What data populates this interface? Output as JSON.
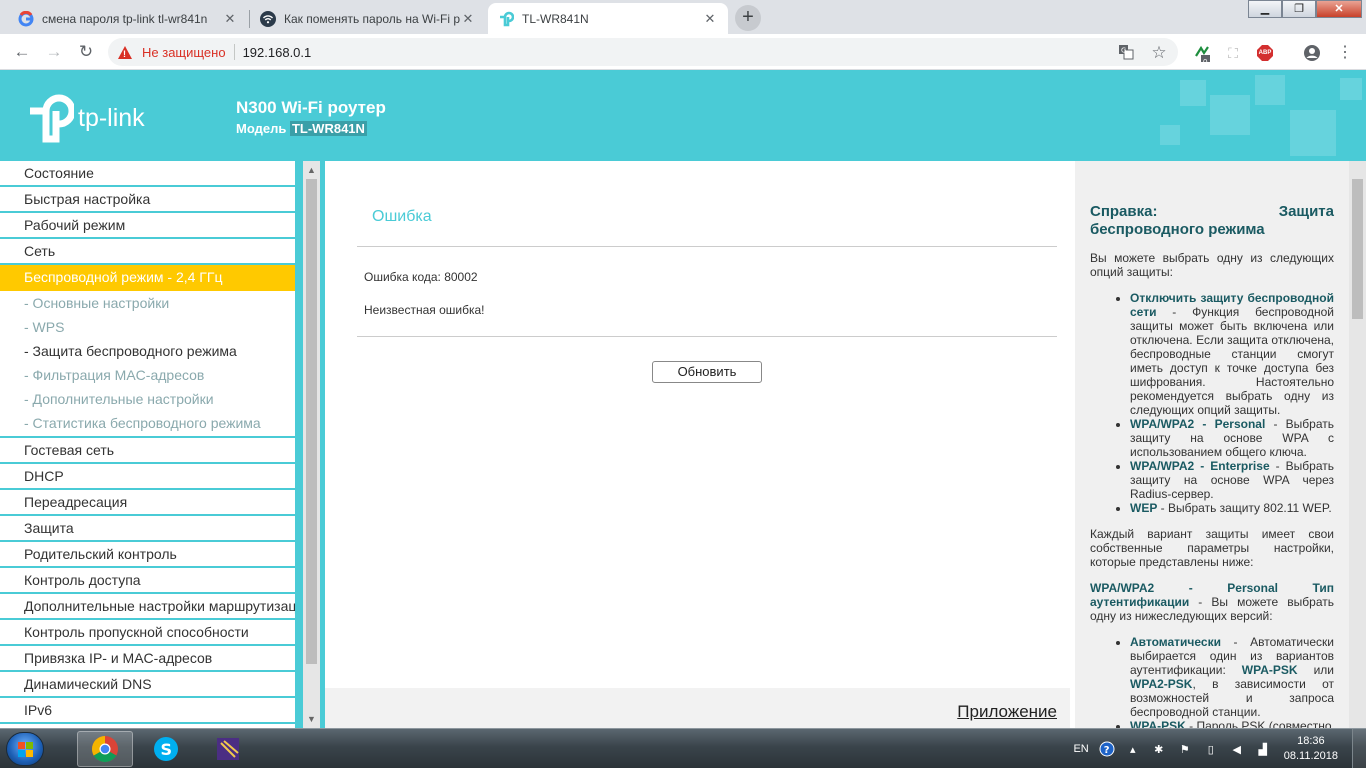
{
  "browser": {
    "tabs": [
      {
        "title": "смена пароля tp-link tl-wr841n",
        "favicon": "google-icon",
        "active": false
      },
      {
        "title": "Как поменять пароль на Wi-Fi р",
        "favicon": "wifi-icon",
        "active": false
      },
      {
        "title": "TL-WR841N",
        "favicon": "tplink-icon",
        "active": true
      }
    ],
    "security_label": "Не защищено",
    "url": "192.168.0.1",
    "extension_badge": "0",
    "abp_label": "ABP"
  },
  "header": {
    "logo_text": "tp-link",
    "product": "N300 Wi-Fi роутер",
    "model_label": "Модель",
    "model_value": "TL-WR841N"
  },
  "sidebar": {
    "items": [
      {
        "label": "Состояние"
      },
      {
        "label": "Быстрая настройка"
      },
      {
        "label": "Рабочий режим"
      },
      {
        "label": "Сеть"
      },
      {
        "label": "Беспроводной режим - 2,4 ГГц",
        "active": true
      },
      {
        "label": "Гостевая сеть"
      },
      {
        "label": "DHCP"
      },
      {
        "label": "Переадресация"
      },
      {
        "label": "Защита"
      },
      {
        "label": "Родительский контроль"
      },
      {
        "label": "Контроль доступа"
      },
      {
        "label": "Дополнительные настройки маршрутизации"
      },
      {
        "label": "Контроль пропускной способности"
      },
      {
        "label": "Привязка IP- и MAC-адресов"
      },
      {
        "label": "Динамический DNS"
      },
      {
        "label": "IPv6"
      }
    ],
    "submenu": [
      {
        "label": "- Основные настройки"
      },
      {
        "label": "- WPS"
      },
      {
        "label": "- Защита беспроводного режима",
        "current": true
      },
      {
        "label": "- Фильтрация MAC-адресов"
      },
      {
        "label": "- Дополнительные настройки"
      },
      {
        "label": "- Статистика беспроводного режима"
      }
    ]
  },
  "main": {
    "title": "Ошибка",
    "error_code": "Ошибка кода: 80002",
    "error_message": "Неизвестная ошибка!",
    "refresh_label": "Обновить",
    "app_link": "Приложение"
  },
  "help": {
    "title": "Справка: Защита беспроводного режима",
    "intro": "Вы можете выбрать одну из следующих опций защиты:",
    "options": [
      {
        "name": "Отключить защиту беспроводной сети",
        "text": " - Функция беспроводной защиты может быть включена или отключена. Если защита отключена, беспроводные станции смогут иметь доступ к точке доступа без шифрования. Настоятельно рекомендуется выбрать одну из следующих опций защиты."
      },
      {
        "name": "WPA/WPA2 - Personal",
        "text": " - Выбрать защиту на основе WPA с использованием общего ключа."
      },
      {
        "name": "WPA/WPA2 - Enterprise",
        "text": " - Выбрать защиту на основе WPA через Radius-сервер."
      },
      {
        "name": "WEP",
        "text": " - Выбрать защиту 802.11 WEP."
      }
    ],
    "para2": "Каждый вариант защиты имеет свои собственные параметры настройки, которые представлены ниже:",
    "section_title": "WPA/WPA2 - Personal Тип аутентификации",
    "section_text": " - Вы можете выбрать одну из нижеследующих версий:",
    "auth_options": [
      {
        "name": "Автоматически",
        "text": " - Автоматически выбирается один из вариантов аутентификации: "
      },
      {
        "name": "WPA-PSK",
        "text": " - Пароль PSK (совместно"
      }
    ],
    "auth_auto_psk1": "WPA-PSK",
    "auth_auto_mid": " или ",
    "auth_auto_psk2": "WPA2-PSK",
    "auth_auto_tail": ", в зависимости от возможностей и запроса беспроводной станции."
  },
  "taskbar": {
    "lang": "EN",
    "time": "18:36",
    "date": "08.11.2018"
  },
  "colors": {
    "brand": "#4acbd6",
    "active_menu": "#ffc900",
    "help_title": "#1a5a62"
  }
}
